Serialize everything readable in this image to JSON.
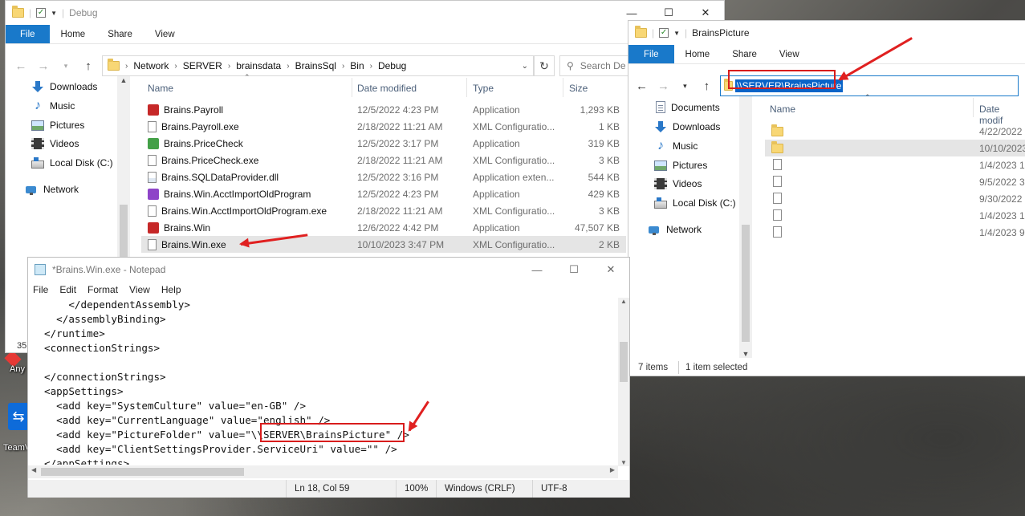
{
  "desktop": {
    "icon1_label": "Any",
    "icon2_label": "TeamV",
    "partial_number": "35"
  },
  "explorer_debug": {
    "title": "Debug",
    "ribbon_tabs": [
      "File",
      "Home",
      "Share",
      "View"
    ],
    "breadcrumb": [
      "Network",
      "SERVER",
      "brainsdata",
      "BrainsSql",
      "Bin",
      "Debug"
    ],
    "search_placeholder": "Search De",
    "nav_items": [
      "Downloads",
      "Music",
      "Pictures",
      "Videos",
      "Local Disk (C:)",
      "Network"
    ],
    "columns": {
      "name": "Name",
      "date": "Date modified",
      "type": "Type",
      "size": "Size"
    },
    "files": [
      {
        "name": "Brains.Payroll",
        "date": "12/5/2022 4:23 PM",
        "type": "Application",
        "size": "1,293 KB",
        "icon": "app-red",
        "icon_color": "#c62828"
      },
      {
        "name": "Brains.Payroll.exe",
        "date": "2/18/2022 11:21 AM",
        "type": "XML Configuratio...",
        "size": "1 KB",
        "icon": "file",
        "icon_color": "#ffffff"
      },
      {
        "name": "Brains.PriceCheck",
        "date": "12/5/2022 3:17 PM",
        "type": "Application",
        "size": "319 KB",
        "icon": "app-green",
        "icon_color": "#43a047"
      },
      {
        "name": "Brains.PriceCheck.exe",
        "date": "2/18/2022 11:21 AM",
        "type": "XML Configuratio...",
        "size": "3 KB",
        "icon": "file",
        "icon_color": "#ffffff"
      },
      {
        "name": "Brains.SQLDataProvider.dll",
        "date": "12/5/2022 3:16 PM",
        "type": "Application exten...",
        "size": "544 KB",
        "icon": "dll",
        "icon_color": "#ffffff"
      },
      {
        "name": "Brains.Win.AcctImportOldProgram",
        "date": "12/5/2022 4:23 PM",
        "type": "Application",
        "size": "429 KB",
        "icon": "app-purple",
        "icon_color": "#8e44c8"
      },
      {
        "name": "Brains.Win.AcctImportOldProgram.exe",
        "date": "2/18/2022 11:21 AM",
        "type": "XML Configuratio...",
        "size": "3 KB",
        "icon": "file",
        "icon_color": "#ffffff"
      },
      {
        "name": "Brains.Win",
        "date": "12/6/2022 4:42 PM",
        "type": "Application",
        "size": "47,507 KB",
        "icon": "app-red",
        "icon_color": "#c62828"
      },
      {
        "name": "Brains.Win.exe",
        "date": "10/10/2023 3:47 PM",
        "type": "XML Configuratio...",
        "size": "2 KB",
        "icon": "file",
        "icon_color": "#ffffff"
      }
    ],
    "selected_index": 8
  },
  "notepad": {
    "title": "*Brains.Win.exe - Notepad",
    "menu": [
      "File",
      "Edit",
      "Format",
      "View",
      "Help"
    ],
    "lines": [
      "    </dependentAssembly>",
      "  </assemblyBinding>",
      "</runtime>",
      "<connectionStrings>",
      "",
      "</connectionStrings>",
      "<appSettings>",
      "  <add key=\"SystemCulture\" value=\"en-GB\" />",
      "  <add key=\"CurrentLanguage\" value=\"english\" />",
      "  <add key=\"PictureFolder\" value=\"\\\\SERVER\\BrainsPicture\" />",
      "  <add key=\"ClientSettingsProvider.ServiceUri\" value=\"\" />",
      "</appSettings>"
    ],
    "status": {
      "position": "Ln 18, Col 59",
      "zoom": "100%",
      "line_ending": "Windows (CRLF)",
      "encoding": "UTF-8"
    }
  },
  "explorer_picture": {
    "title": "BrainsPicture",
    "ribbon_tabs": [
      "File",
      "Home",
      "Share",
      "View"
    ],
    "address": "\\\\SERVER\\BrainsPicture",
    "nav_items": [
      "Documents",
      "Downloads",
      "Music",
      "Pictures",
      "Videos",
      "Local Disk (C:)",
      "Network"
    ],
    "columns": {
      "name": "Name",
      "date": "Date modif"
    },
    "items": [
      {
        "kind": "folder",
        "date": "4/22/2022 1"
      },
      {
        "kind": "folder",
        "date": "10/10/2023"
      },
      {
        "kind": "file",
        "date": "1/4/2023 10"
      },
      {
        "kind": "file",
        "date": "9/5/2022 3:"
      },
      {
        "kind": "file",
        "date": "9/30/2022 5"
      },
      {
        "kind": "file",
        "date": "1/4/2023 10"
      },
      {
        "kind": "file",
        "date": "1/4/2023 9:"
      }
    ],
    "selected_index": 1,
    "status_items": "7 items",
    "status_selected": "1 item selected"
  },
  "colors": {
    "accent": "#1979ca",
    "highlight_red": "#d81c1c",
    "selection": "#cce8ff"
  }
}
